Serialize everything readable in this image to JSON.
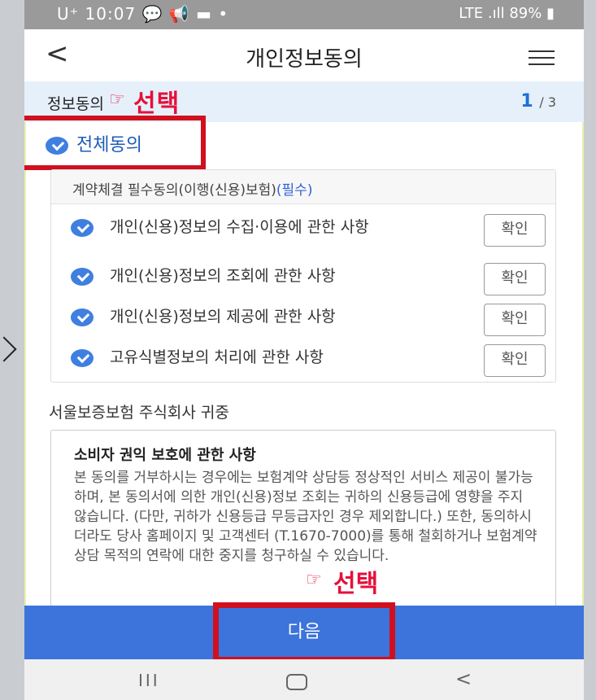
{
  "status_bar": {
    "left": "U⁺ 10:07 💬 📢 ▬ •",
    "right": "LTE .ıll 89% ▮"
  },
  "header": {
    "back_icon": "<",
    "title": "개인정보동의"
  },
  "step": {
    "label": "정보동의",
    "annotation": "선택",
    "current": "1",
    "total": "/ 3"
  },
  "agree_all": {
    "label": "전체동의"
  },
  "required_section": {
    "title": "계약체결 필수동의(이행(신용)보험)",
    "required_tag": "(필수)",
    "items": [
      {
        "label": "개인(신용)정보의 수집·이용에 관한 사항",
        "button": "확인"
      },
      {
        "label": "개인(신용)정보의 조회에 관한 사항",
        "button": "확인"
      },
      {
        "label": "개인(신용)정보의 제공에 관한 사항",
        "button": "확인"
      },
      {
        "label": "고유식별정보의 처리에 관한 사항",
        "button": "확인"
      }
    ]
  },
  "notice": {
    "addressee": "서울보증보험 주식회사 귀중",
    "title": "소비자 권익 보호에 관한 사항",
    "body": "본 동의를 거부하시는 경우에는 보험계약 상담등 정상적인 서비스 제공이 불가능하며, 본 동의서에 의한 개인(신용)정보 조회는 귀하의 신용등급에 영향을 주지 않습니다. (다만, 귀하가 신용등급 무등급자인 경우 제외합니다.) 또한, 동의하시더라도 당사 홈페이지 및 고객센터 (T.1670-7000)를 통해 철회하거나 보험계약 상담 목적의 연락에 대한 중지를 청구하실 수 있습니다.",
    "annotation": "선택"
  },
  "next_button": {
    "label": "다음"
  },
  "nav_bar": {
    "recents": "III",
    "home": "◯",
    "back": "<"
  }
}
